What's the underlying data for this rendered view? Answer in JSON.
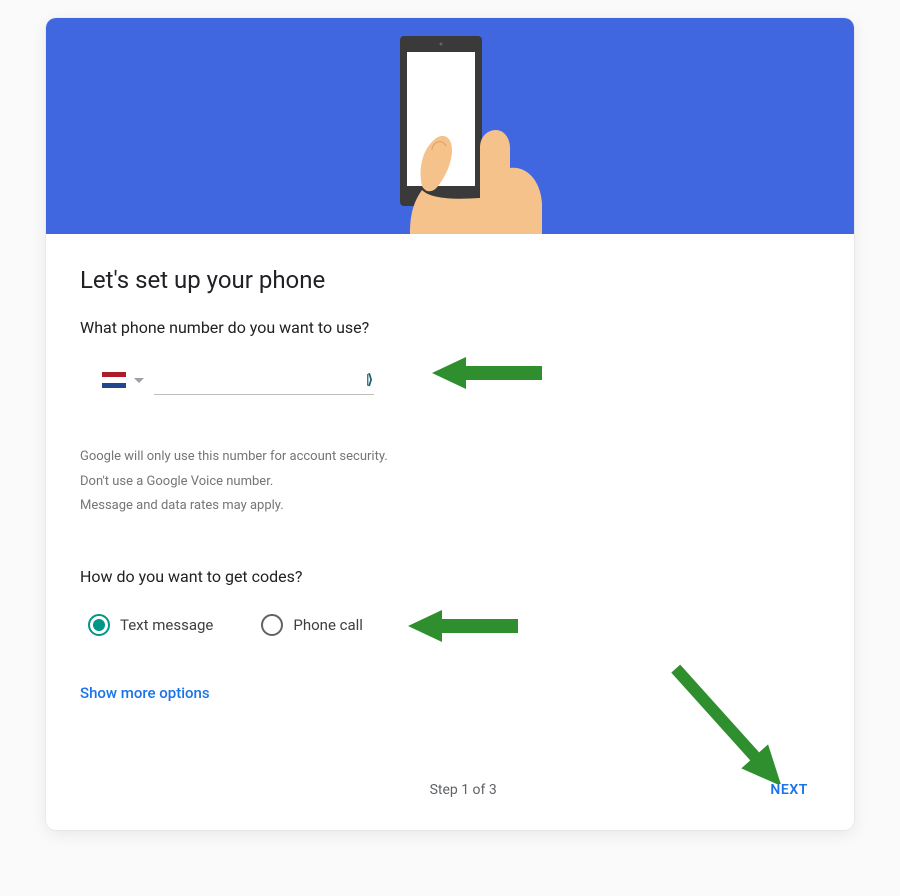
{
  "title": "Let's set up your phone",
  "question_phone": "What phone number do you want to use?",
  "country": {
    "flag_colors": {
      "top": "#AE1C28",
      "middle": "#FFFFFF",
      "bottom": "#21468B"
    }
  },
  "phone_input": {
    "value": "",
    "placeholder": ""
  },
  "notes": [
    "Google will only use this number for account security.",
    "Don't use a Google Voice number.",
    "Message and data rates may apply."
  ],
  "question_codes": "How do you want to get codes?",
  "code_options": [
    {
      "label": "Text message",
      "selected": true
    },
    {
      "label": "Phone call",
      "selected": false
    }
  ],
  "show_more_label": "Show more options",
  "step_label": "Step 1 of 3",
  "next_label": "NEXT",
  "annotation_color": "#2f8f2f"
}
